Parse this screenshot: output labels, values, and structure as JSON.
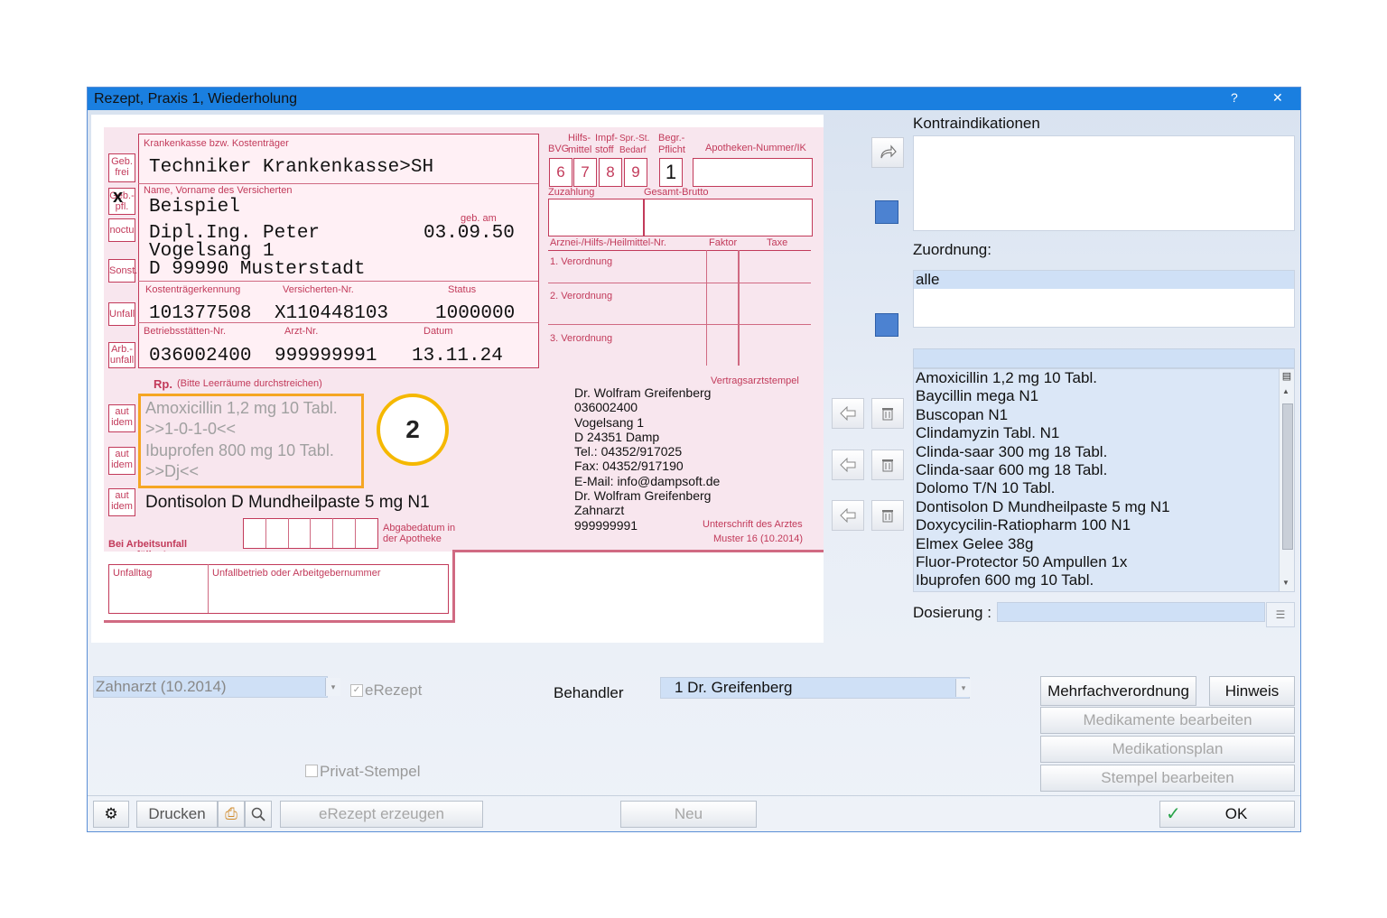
{
  "window": {
    "title": "Rezept, Praxis 1, Wiederholung",
    "help": "?",
    "close": "✕"
  },
  "form": {
    "side_boxes": [
      "Geb. frei",
      "Geb.- pfl.",
      "noctu",
      "Sonst.",
      "Unfall",
      "Arb.- unfall"
    ],
    "cross": "x",
    "labels": {
      "kasse": "Krankenkasse bzw. Kostenträger",
      "name": "Name, Vorname des Versicherten",
      "geb_am": "geb. am",
      "kostentraegerkennung": "Kostenträgerkennung",
      "versichertennr": "Versicherten-Nr.",
      "status": "Status",
      "betriebsstaette": "Betriebsstätten-Nr.",
      "arztnr": "Arzt-Nr.",
      "datum": "Datum",
      "bvg": "BVG",
      "hilfsmittel": "Hilfs- mittel",
      "impfstoff": "Impf- stoff",
      "sprst": "Spr.-St. Bedarf",
      "begr": "Begr.- Pflicht",
      "apotheken": "Apotheken-Nummer/IK",
      "zuzahlung": "Zuzahlung",
      "gesamtbrutto": "Gesamt-Brutto",
      "arznei": "Arznei-/Hilfs-/Heilmittel-Nr.",
      "faktor": "Faktor",
      "taxe": "Taxe",
      "v1": "1. Verordnung",
      "v2": "2. Verordnung",
      "v3": "3. Verordnung",
      "rp": "Rp.",
      "rp_hint": "(Bitte Leerräume durchstreichen)",
      "vertragsarztstempel": "Vertragsarztstempel",
      "abgabedatum": "Abgabedatum in der Apotheke",
      "unterschrift": "Unterschrift des Arztes",
      "muster": "Muster 16 (10.2014)",
      "arbeitsunfall": "Bei Arbeitsunfall auszufüllen!",
      "unfalltag": "Unfalltag",
      "unfallbetrieb": "Unfallbetrieb oder Arbeitgebernummer",
      "aut_idem": "aut idem"
    },
    "digits": [
      "6",
      "7",
      "8",
      "9"
    ],
    "begr_value": "1",
    "kasse": "Techniker Krankenkasse>SH",
    "nachname": "Beispiel",
    "vorname": "Dipl.Ing. Peter",
    "geburtsdatum": "03.09.50",
    "strasse": "Vogelsang 1",
    "ort": "D 99990 Musterstadt",
    "kostentraegerkennung": "101377508",
    "versichertennr": "X110448103",
    "status": "1000000",
    "betriebsstaette": "036002400",
    "arztnr": "999999991",
    "datum": "13.11.24",
    "rx": [
      "Amoxicillin 1,2 mg 10 Tabl.",
      ">>1-0-1-0<<",
      "Ibuprofen 800 mg 10 Tabl.",
      ">>Dj<<"
    ],
    "rx3": "Dontisolon D Mundheilpaste 5 mg N1",
    "callout": "2",
    "stamp": [
      "Dr. Wolfram Greifenberg",
      "036002400",
      "Vogelsang 1",
      "D 24351 Damp",
      "Tel.: 04352/917025",
      "Fax: 04352/917190",
      "E-Mail: info@dampsoft.de",
      "Dr. Wolfram Greifenberg",
      "Zahnarzt",
      "999999991"
    ]
  },
  "right": {
    "kontraindikationen": "Kontraindikationen",
    "zuordnung": "Zuordnung:",
    "zuordnung_value": "alle",
    "medications": [
      "Amoxicillin 1,2 mg 10 Tabl.",
      "Baycillin mega N1",
      "Buscopan N1",
      "Clindamyzin Tabl. N1",
      "Clinda-saar 300 mg 18 Tabl.",
      "Clinda-saar 600 mg 18 Tabl.",
      "Dolomo T/N 10 Tabl.",
      "Dontisolon D Mundheilpaste 5 mg N1",
      "Doxycycilin-Ratiopharm 100 N1",
      "Elmex Gelee 38g",
      "Fluor-Protector 50 Ampullen 1x",
      "Ibuprofen 600 mg 10 Tabl."
    ],
    "dosierung": "Dosierung :"
  },
  "bottom": {
    "formular": "Zahnarzt (10.2014)",
    "erezept": "eRezept",
    "behandler_label": "Behandler",
    "behandler": "1 Dr. Greifenberg",
    "privat_stempel": "Privat-Stempel",
    "mehrfach": "Mehrfachverordnung",
    "hinweis": "Hinweis",
    "medikamente": "Medikamente bearbeiten",
    "medikationsplan": "Medikationsplan",
    "stempel": "Stempel bearbeiten",
    "drucken": "Drucken",
    "erezept_erzeugen": "eRezept erzeugen",
    "neu": "Neu",
    "ok": "OK"
  }
}
